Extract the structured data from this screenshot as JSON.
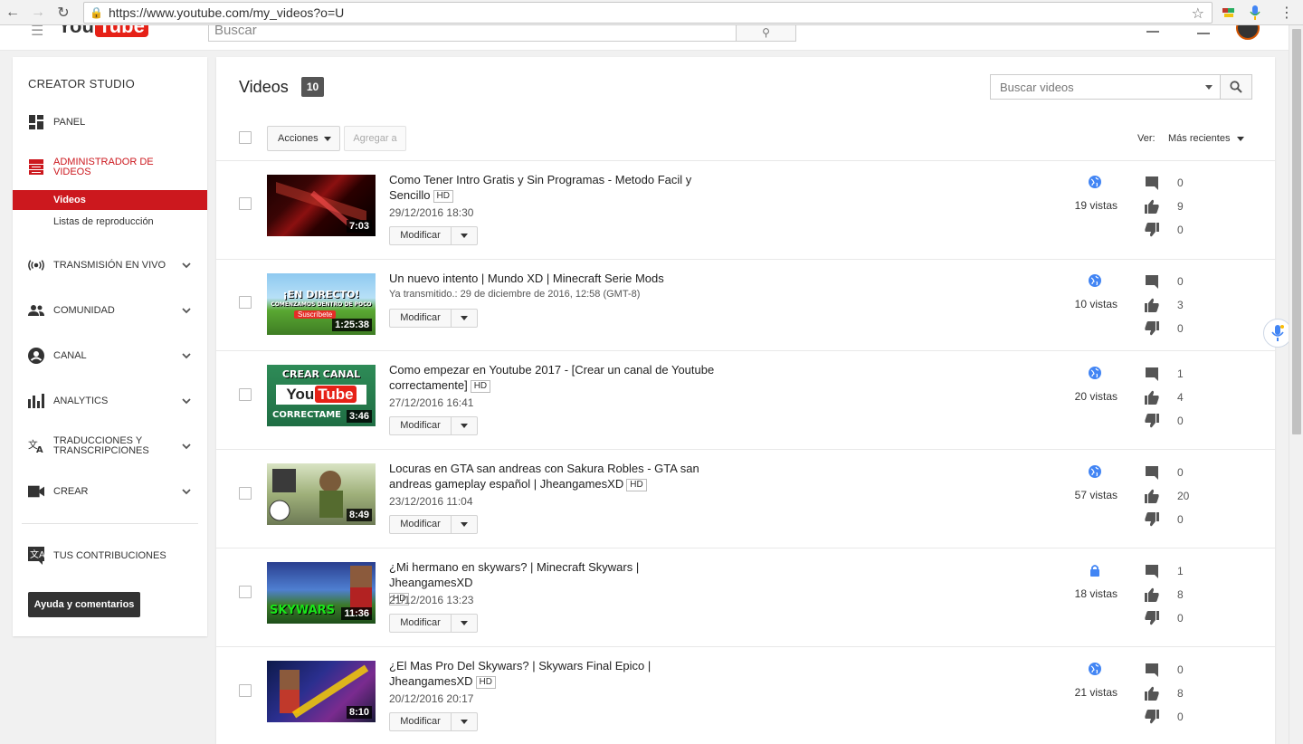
{
  "browser": {
    "url": "https://www.youtube.com/my_videos?o=U"
  },
  "topbar": {
    "search_placeholder": "Buscar",
    "logo_you": "You",
    "logo_tube": "Tube"
  },
  "sidebar": {
    "title": "CREATOR STUDIO",
    "panel": "PANEL",
    "video_manager": "ADMINISTRADOR DE VIDEOS",
    "sub_videos": "Videos",
    "sub_playlists": "Listas de reproducción",
    "live": "TRANSMISIÓN EN VIVO",
    "community": "COMUNIDAD",
    "channel": "CANAL",
    "analytics": "ANALYTICS",
    "translations": "TRADUCCIONES Y TRANSCRIPCIONES",
    "create": "CREAR",
    "contributions": "TUS CONTRIBUCIONES",
    "help_button": "Ayuda y comentarios"
  },
  "main": {
    "title": "Videos",
    "count": "10",
    "search_placeholder": "Buscar videos",
    "actions_label": "Acciones",
    "add_to_label": "Agregar a",
    "sort_prefix": "Ver:",
    "sort_value": "Más recientes"
  },
  "videos": [
    {
      "title": "Como Tener Intro Gratis y Sin Programas - Metodo Facil y Sencillo",
      "hd": "HD",
      "date": "29/12/2016 18:30",
      "duration": "7:03",
      "edit_label": "Modificar",
      "privacy": "public",
      "views": "19 vistas",
      "comments": "0",
      "likes": "9",
      "dislikes": "0"
    },
    {
      "title": "Un nuevo intento | Mundo XD | Minecraft Serie Mods",
      "hd": "",
      "date": "Ya transmitido.: 29 de diciembre de 2016, 12:58 (GMT-8)",
      "duration": "1:25:38",
      "thumb_text1": "¡EN DIRECTO!",
      "thumb_text2": "COMENZAMOS DENTRO DE POCO",
      "thumb_text3": "Suscríbete",
      "edit_label": "Modificar",
      "privacy": "public",
      "views": "10 vistas",
      "comments": "0",
      "likes": "3",
      "dislikes": "0"
    },
    {
      "title": "Como empezar en Youtube 2017 - [Crear un canal de Youtube correctamente]",
      "hd": "HD",
      "date": "27/12/2016 16:41",
      "duration": "3:46",
      "thumb_text1": "CREAR CANAL",
      "thumb_text2": "You",
      "thumb_text3": "Tube",
      "thumb_text4": "CORRECTAME",
      "edit_label": "Modificar",
      "privacy": "public",
      "views": "20 vistas",
      "comments": "1",
      "likes": "4",
      "dislikes": "0"
    },
    {
      "title": "Locuras en GTA san andreas con Sakura Robles - GTA san andreas gameplay español | JheangamesXD",
      "hd": "HD",
      "date": "23/12/2016 11:04",
      "duration": "8:49",
      "edit_label": "Modificar",
      "privacy": "public",
      "views": "57 vistas",
      "comments": "0",
      "likes": "20",
      "dislikes": "0"
    },
    {
      "title": "¿Mi hermano en skywars? | Minecraft Skywars | JheangamesXD",
      "hd": "HD",
      "date": "21/12/2016 13:23",
      "duration": "11:36",
      "thumb_text1": "SKYWARS",
      "edit_label": "Modificar",
      "privacy": "private",
      "views": "18 vistas",
      "comments": "1",
      "likes": "8",
      "dislikes": "0"
    },
    {
      "title": "¿El Mas Pro Del Skywars? | Skywars Final Epico | JheangamesXD",
      "hd": "HD",
      "date": "20/12/2016 20:17",
      "duration": "8:10",
      "edit_label": "Modificar",
      "privacy": "public",
      "views": "21 vistas",
      "comments": "0",
      "likes": "8",
      "dislikes": "0"
    }
  ],
  "colors": {
    "accent": "#cc181e",
    "public_icon": "#4285f4"
  }
}
